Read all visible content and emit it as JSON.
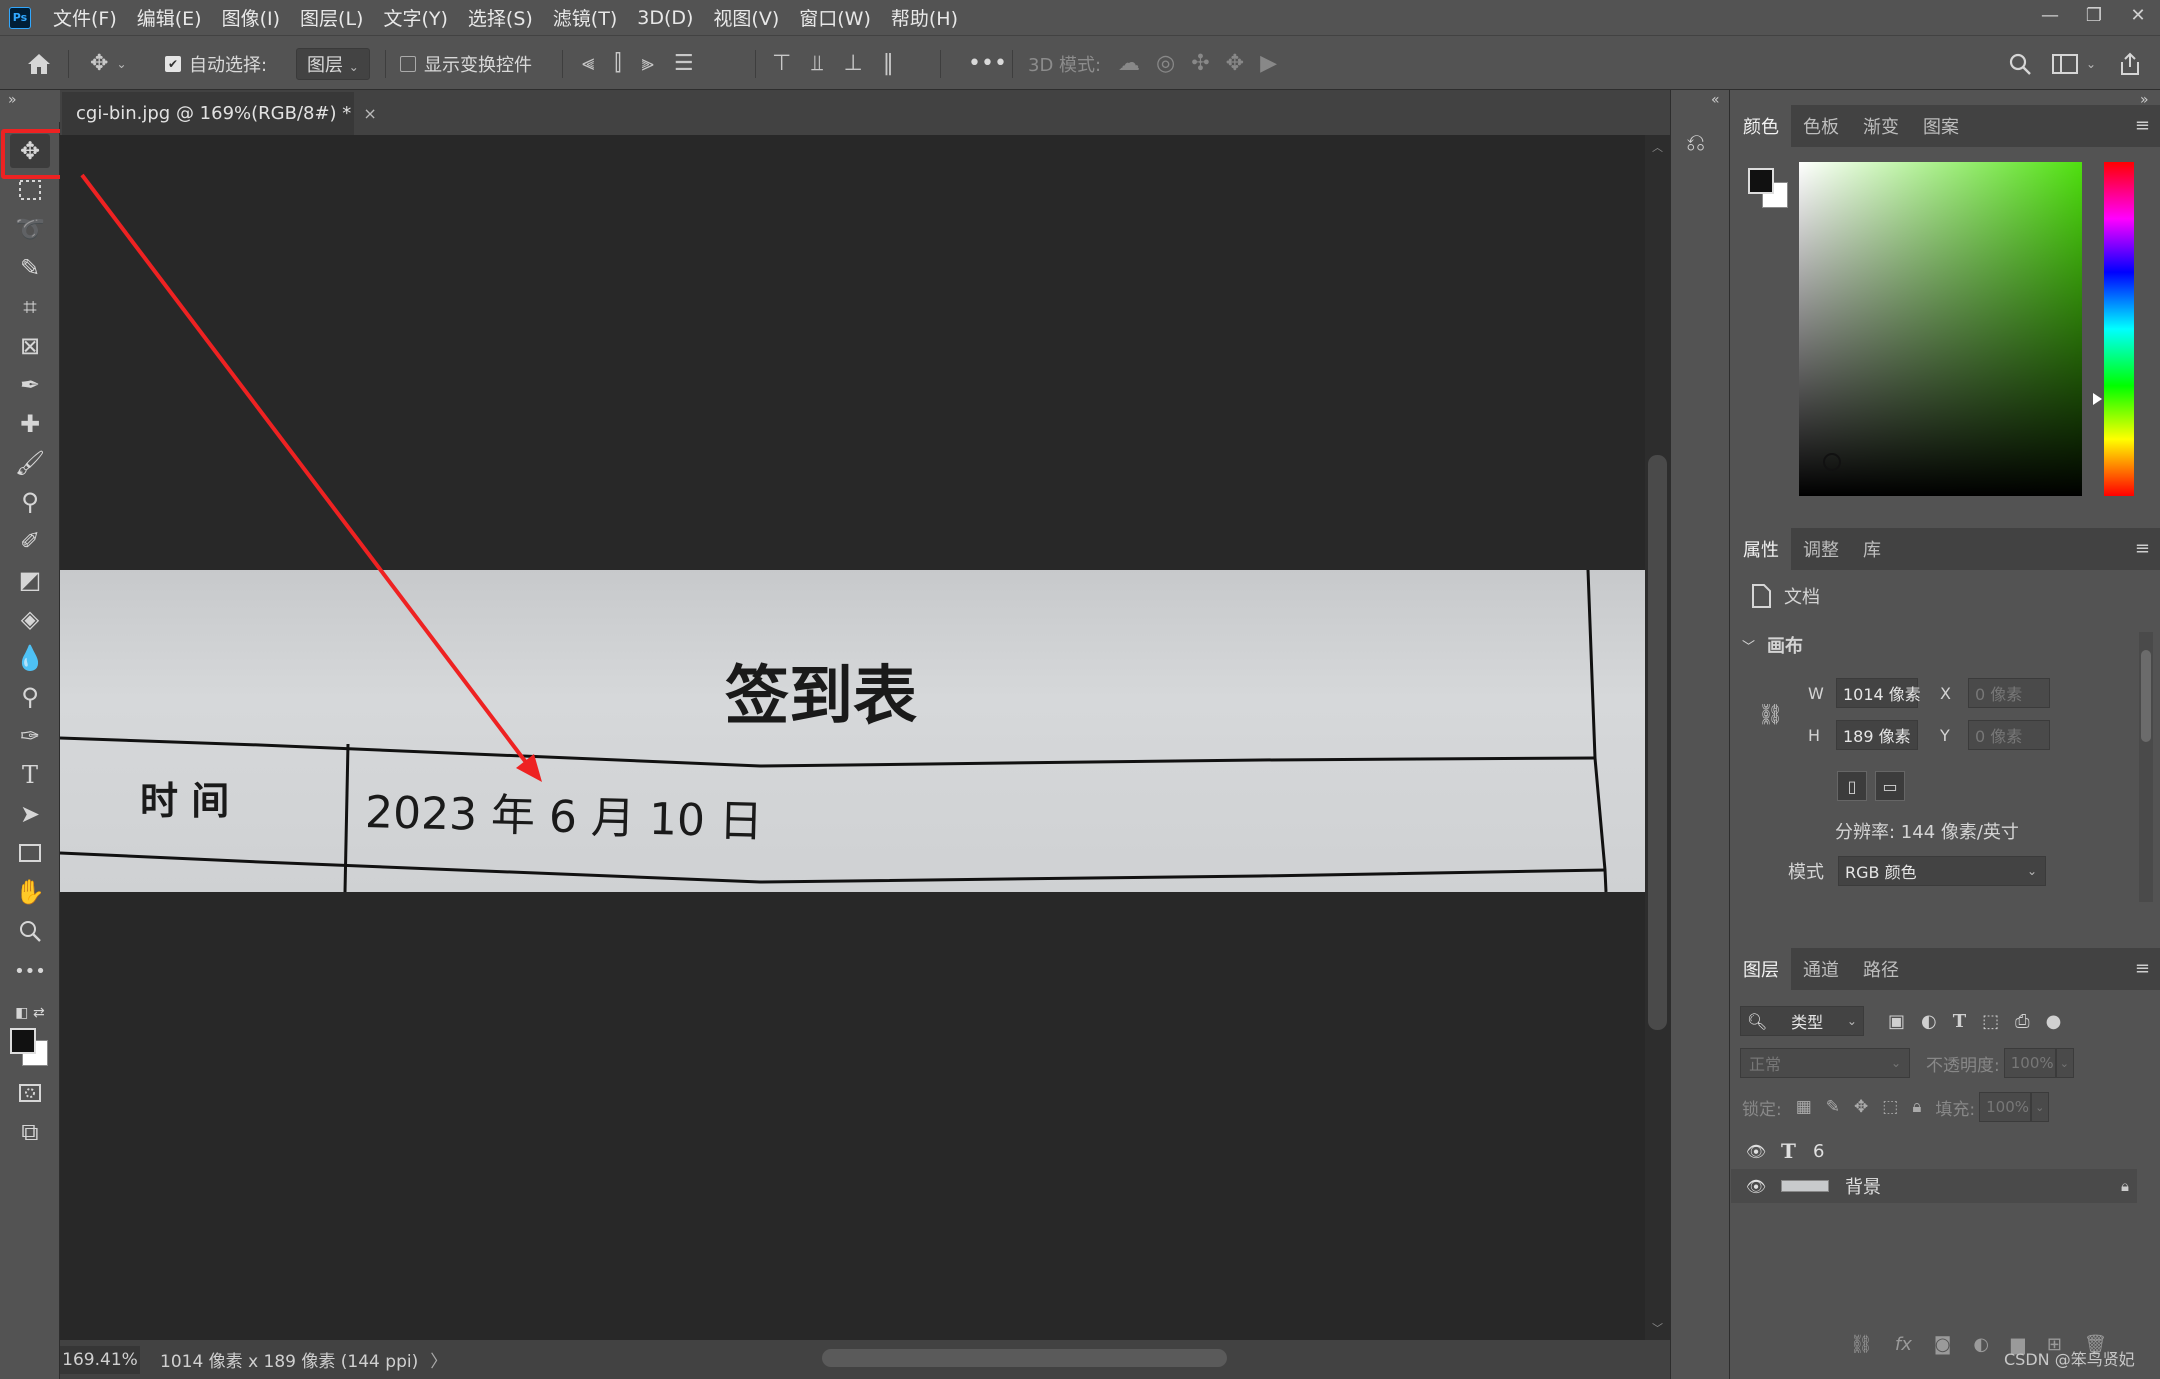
{
  "app": {
    "logo": "Ps"
  },
  "menu": [
    "文件(F)",
    "编辑(E)",
    "图像(I)",
    "图层(L)",
    "文字(Y)",
    "选择(S)",
    "滤镜(T)",
    "3D(D)",
    "视图(V)",
    "窗口(W)",
    "帮助(H)"
  ],
  "window_controls": {
    "minimize": "—",
    "restore": "❐",
    "close": "✕"
  },
  "options": {
    "auto_select_label": "自动选择:",
    "auto_select_checked": true,
    "auto_select_target": "图层",
    "show_transform_label": "显示变换控件",
    "show_transform_checked": false,
    "more": "•••",
    "mode_3d_label": "3D 模式:"
  },
  "document": {
    "tab_title": "cgi-bin.jpg @ 169%(RGB/8#) *",
    "close": "×"
  },
  "image_content": {
    "title": "签到表",
    "row_label": "时 间",
    "row_value": "2023 年 6 月 10 日"
  },
  "status": {
    "zoom": "169.41%",
    "doc_info": "1014 像素 x 189 像素 (144 ppi)",
    "arrow": "〉"
  },
  "color_panel": {
    "tabs": [
      "颜色",
      "色板",
      "渐变",
      "图案"
    ],
    "active_tab": 0,
    "hue_color": "#4fe00f",
    "foreground": "#111111",
    "background": "#ffffff"
  },
  "properties_panel": {
    "tabs": [
      "属性",
      "调整",
      "库"
    ],
    "doc_label": "文档",
    "section": "画布",
    "w_label": "W",
    "w_value": "1014 像素",
    "h_label": "H",
    "h_value": "189 像素",
    "x_label": "X",
    "x_placeholder": "0 像素",
    "y_label": "Y",
    "y_placeholder": "0 像素",
    "resolution": "分辨率: 144 像素/英寸",
    "mode_label": "模式",
    "mode_value": "RGB 颜色"
  },
  "layers_panel": {
    "tabs": [
      "图层",
      "通道",
      "路径"
    ],
    "filter_label": "类型",
    "blend_mode": "正常",
    "opacity_label": "不透明度:",
    "opacity_value": "100%",
    "lock_label": "锁定:",
    "fill_label": "填充:",
    "fill_value": "100%",
    "layers": [
      {
        "name": "6",
        "type": "text"
      },
      {
        "name": "背景",
        "type": "image",
        "locked": true
      }
    ]
  },
  "watermark": "CSDN @笨鸟贤妃"
}
